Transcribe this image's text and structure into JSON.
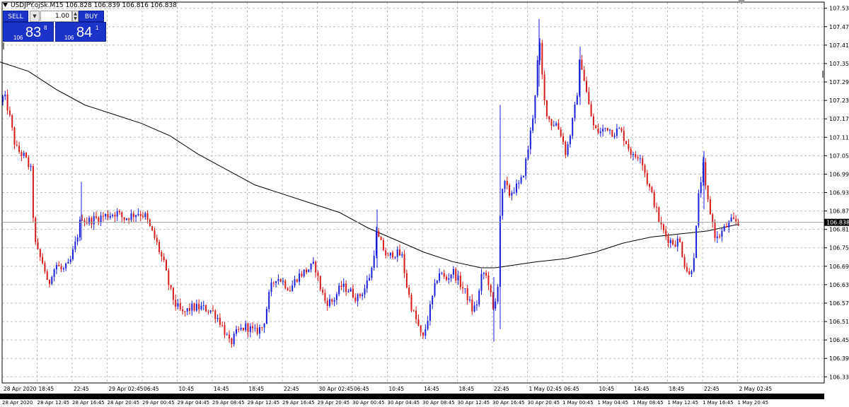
{
  "header": {
    "symbol_info": "USDJPY.ojSk.M15  106.828 106.839 106.816 106.838"
  },
  "trade_panel": {
    "sell_label": "SELL",
    "buy_label": "BUY",
    "lot_value": "1.00",
    "sell_price_prefix": "106",
    "sell_price_big": "83",
    "sell_price_sup": "8",
    "buy_price_prefix": "106",
    "buy_price_big": "84",
    "buy_price_sup": "1"
  },
  "colors": {
    "bull": "#1a1fd8",
    "bear": "#d41a1a",
    "grid": "#c0c0c0",
    "ma": "#000000",
    "price_line": "#a0a0a0"
  },
  "chart_data": {
    "type": "candlestick",
    "symbol": "USDJPY.ojSk",
    "timeframe": "M15",
    "grid": true,
    "ylim": [
      106.315,
      107.555
    ],
    "current_price": "106.838",
    "y_ticks": [
      "107.535",
      "107.475",
      "107.415",
      "107.355",
      "107.295",
      "107.235",
      "107.175",
      "107.115",
      "107.055",
      "106.995",
      "106.935",
      "106.875",
      "106.815",
      "106.755",
      "106.695",
      "106.635",
      "106.575",
      "106.515",
      "106.455",
      "106.395",
      "106.335"
    ],
    "x_ticks_top": [
      "28 Apr 2020",
      "18:45",
      "22:45",
      "29 Apr 02:45",
      "06:45",
      "10:45",
      "14:45",
      "18:45",
      "22:45",
      "30 Apr 02:45",
      "06:45",
      "10:45",
      "14:45",
      "18:45",
      "22:45",
      "1 May 02:45",
      "06:45",
      "10:45",
      "14:45",
      "18:45",
      "22:45",
      "2 May 02:45"
    ],
    "x_ticks_bottom": [
      "28 Apr 2020",
      "28 Apr 12:45",
      "28 Apr 16:45",
      "28 Apr 20:45",
      "29 Apr 00:45",
      "29 Apr 04:45",
      "29 Apr 08:45",
      "29 Apr 12:45",
      "29 Apr 16:45",
      "29 Apr 20:45",
      "30 Apr 00:45",
      "30 Apr 04:45",
      "30 Apr 08:45",
      "30 Apr 12:45",
      "30 Apr 16:45",
      "30 Apr 20:45",
      "1 May 00:45",
      "1 May 04:45",
      "1 May 08:45",
      "1 May 12:45",
      "1 May 16:45",
      "1 May 20:45"
    ],
    "price_path": [
      [
        0,
        107.23
      ],
      [
        6,
        107.25
      ],
      [
        12,
        107.2
      ],
      [
        22,
        107.08
      ],
      [
        35,
        107.05
      ],
      [
        45,
        107.0
      ],
      [
        48,
        106.78
      ],
      [
        55,
        106.73
      ],
      [
        62,
        106.7
      ],
      [
        68,
        106.62
      ],
      [
        72,
        106.67
      ],
      [
        80,
        106.7
      ],
      [
        88,
        106.68
      ],
      [
        98,
        106.7
      ],
      [
        108,
        106.78
      ],
      [
        115,
        106.86
      ],
      [
        122,
        106.84
      ],
      [
        135,
        106.85
      ],
      [
        150,
        106.86
      ],
      [
        165,
        106.87
      ],
      [
        175,
        106.85
      ],
      [
        185,
        106.86
      ],
      [
        195,
        106.87
      ],
      [
        205,
        106.86
      ],
      [
        212,
        106.82
      ],
      [
        220,
        106.78
      ],
      [
        232,
        106.7
      ],
      [
        240,
        106.62
      ],
      [
        248,
        106.57
      ],
      [
        258,
        106.54
      ],
      [
        270,
        106.56
      ],
      [
        285,
        106.56
      ],
      [
        300,
        106.55
      ],
      [
        310,
        106.52
      ],
      [
        318,
        106.48
      ],
      [
        325,
        106.44
      ],
      [
        335,
        106.48
      ],
      [
        348,
        106.5
      ],
      [
        360,
        106.48
      ],
      [
        372,
        106.5
      ],
      [
        382,
        106.62
      ],
      [
        390,
        106.66
      ],
      [
        398,
        106.65
      ],
      [
        410,
        106.62
      ],
      [
        420,
        106.66
      ],
      [
        432,
        106.68
      ],
      [
        445,
        106.7
      ],
      [
        452,
        106.63
      ],
      [
        460,
        106.58
      ],
      [
        470,
        106.58
      ],
      [
        482,
        106.63
      ],
      [
        492,
        106.62
      ],
      [
        505,
        106.59
      ],
      [
        515,
        106.62
      ],
      [
        525,
        106.68
      ],
      [
        532,
        106.8
      ],
      [
        540,
        106.76
      ],
      [
        548,
        106.72
      ],
      [
        556,
        106.74
      ],
      [
        568,
        106.73
      ],
      [
        575,
        106.63
      ],
      [
        583,
        106.55
      ],
      [
        590,
        106.51
      ],
      [
        597,
        106.45
      ],
      [
        604,
        106.52
      ],
      [
        612,
        106.6
      ],
      [
        620,
        106.68
      ],
      [
        630,
        106.65
      ],
      [
        640,
        106.68
      ],
      [
        650,
        106.64
      ],
      [
        660,
        106.6
      ],
      [
        668,
        106.55
      ],
      [
        675,
        106.58
      ],
      [
        682,
        106.68
      ],
      [
        690,
        106.65
      ],
      [
        697,
        106.55
      ],
      [
        703,
        106.6
      ],
      [
        707,
        106.87
      ],
      [
        712,
        106.97
      ],
      [
        720,
        106.93
      ],
      [
        728,
        106.95
      ],
      [
        735,
        106.96
      ],
      [
        742,
        107.02
      ],
      [
        748,
        107.1
      ],
      [
        754,
        107.2
      ],
      [
        758,
        107.3
      ],
      [
        762,
        107.44
      ],
      [
        766,
        107.32
      ],
      [
        770,
        107.22
      ],
      [
        778,
        107.16
      ],
      [
        786,
        107.16
      ],
      [
        794,
        107.12
      ],
      [
        800,
        107.06
      ],
      [
        808,
        107.15
      ],
      [
        815,
        107.24
      ],
      [
        820,
        107.38
      ],
      [
        826,
        107.3
      ],
      [
        832,
        107.22
      ],
      [
        840,
        107.14
      ],
      [
        848,
        107.13
      ],
      [
        858,
        107.15
      ],
      [
        866,
        107.13
      ],
      [
        876,
        107.14
      ],
      [
        885,
        107.1
      ],
      [
        895,
        107.05
      ],
      [
        905,
        107.06
      ],
      [
        915,
        106.97
      ],
      [
        925,
        106.9
      ],
      [
        933,
        106.83
      ],
      [
        942,
        106.79
      ],
      [
        952,
        106.77
      ],
      [
        960,
        106.78
      ],
      [
        968,
        106.7
      ],
      [
        975,
        106.66
      ],
      [
        982,
        106.75
      ],
      [
        988,
        106.94
      ],
      [
        994,
        107.02
      ],
      [
        998,
        106.93
      ],
      [
        1005,
        106.86
      ],
      [
        1012,
        106.78
      ],
      [
        1018,
        106.8
      ],
      [
        1025,
        106.82
      ],
      [
        1033,
        106.84
      ],
      [
        1040,
        106.84
      ],
      [
        1045,
        106.838
      ]
    ],
    "ma_path": [
      [
        0,
        107.36
      ],
      [
        40,
        107.33
      ],
      [
        80,
        107.27
      ],
      [
        120,
        107.22
      ],
      [
        160,
        107.19
      ],
      [
        200,
        107.16
      ],
      [
        240,
        107.12
      ],
      [
        280,
        107.06
      ],
      [
        320,
        107.01
      ],
      [
        360,
        106.96
      ],
      [
        400,
        106.93
      ],
      [
        440,
        106.9
      ],
      [
        480,
        106.87
      ],
      [
        520,
        106.82
      ],
      [
        560,
        106.78
      ],
      [
        600,
        106.74
      ],
      [
        640,
        106.71
      ],
      [
        680,
        106.69
      ],
      [
        700,
        106.69
      ],
      [
        730,
        106.7
      ],
      [
        760,
        106.71
      ],
      [
        800,
        106.72
      ],
      [
        840,
        106.74
      ],
      [
        880,
        106.77
      ],
      [
        920,
        106.79
      ],
      [
        960,
        106.8
      ],
      [
        1000,
        106.81
      ],
      [
        1040,
        106.83
      ],
      [
        1045,
        106.83
      ]
    ]
  }
}
